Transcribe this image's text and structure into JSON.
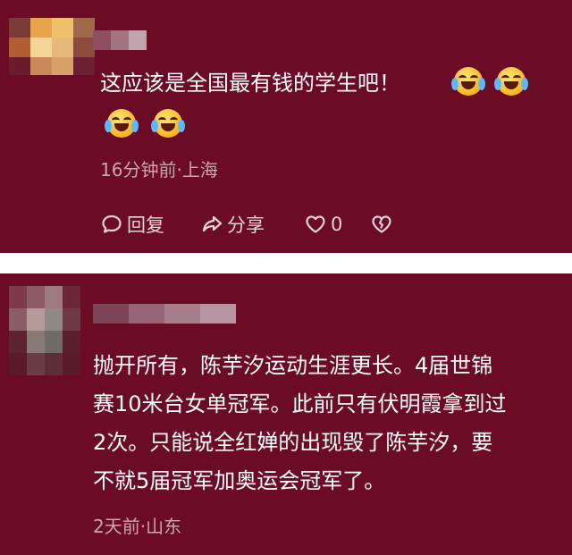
{
  "comments": [
    {
      "text_lines": [
        "这应该是全国最有钱的学生吧！"
      ],
      "emoji_name": "crying-laughing-emoji",
      "meta": "16分钟前·上海",
      "actions": {
        "reply_label": "回复",
        "share_label": "分享",
        "like_count": "0"
      }
    },
    {
      "text_lines": [
        "抛开所有，陈芋汐运动生涯更长。4届世锦",
        "赛10米台女单冠军。此前只有伏明霞拿到过",
        "2次。只能说全红婵的出现毁了陈芋汐，要",
        "不就5届冠军加奥运会冠军了。"
      ],
      "meta": "2天前·山东"
    }
  ],
  "colors": {
    "card_bg": "#6b0b26",
    "text": "#ffffff",
    "meta": "#c9a6b1"
  }
}
